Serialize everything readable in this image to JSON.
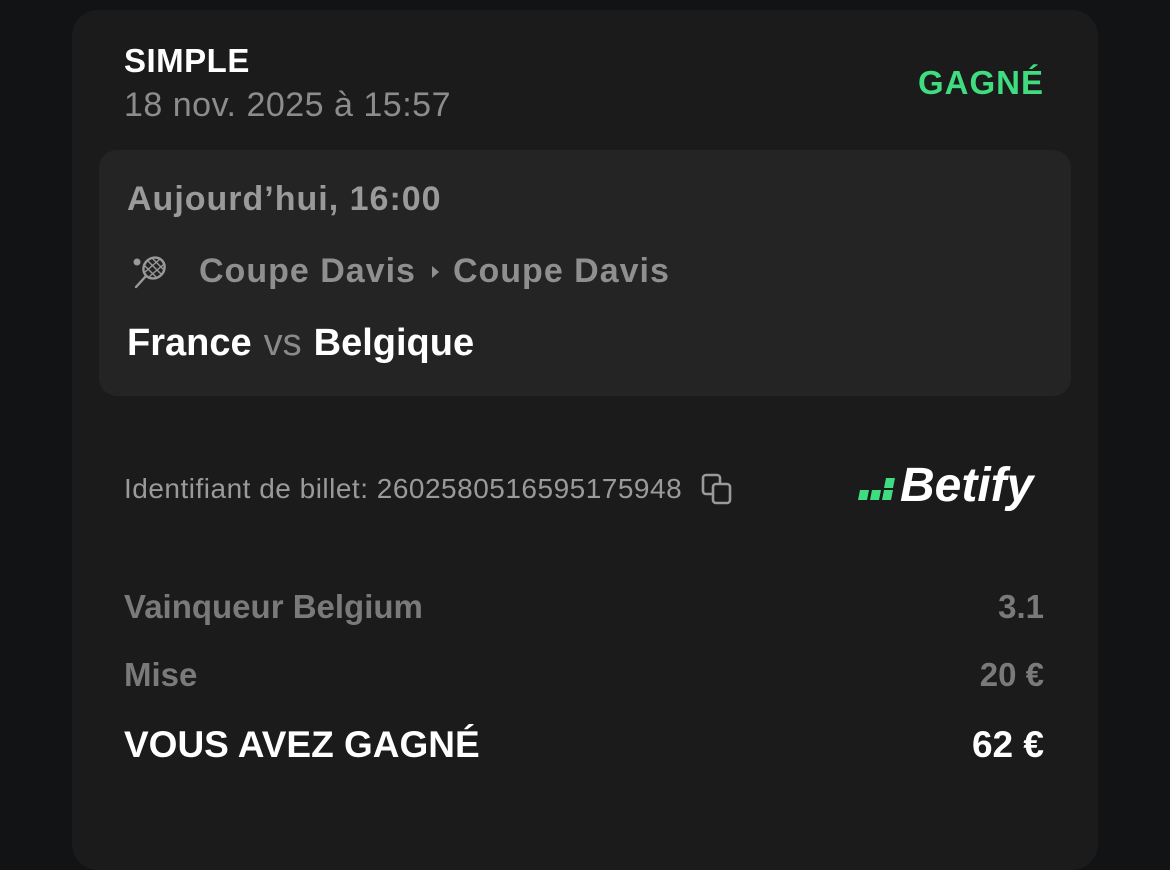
{
  "bet": {
    "type": "SIMPLE",
    "placed_at": "18 nov. 2025 à 15:57",
    "status": "GAGNÉ"
  },
  "event": {
    "time": "Aujourd’hui, 16:00",
    "sport_icon": "tennis-racket-icon",
    "competition": "Coupe Davis",
    "tournament": "Coupe Davis",
    "home_team": "France",
    "vs": "vs",
    "away_team": "Belgique"
  },
  "ticket": {
    "id_label": "Identifiant de billet: 2602580516595175948",
    "copy_icon": "copy-icon"
  },
  "brand": {
    "name": "Betify",
    "accent": "#3fdc80"
  },
  "details": {
    "selection_label": "Vainqueur Belgium",
    "odds": "3.1",
    "stake_label": "Mise",
    "stake_value": "20 €",
    "win_label": "VOUS AVEZ GAGNÉ",
    "win_value": "62 €"
  },
  "colors": {
    "background": "#121314",
    "card": "#1b1b1b",
    "event_box": "#242424",
    "win_green": "#3fdc80"
  }
}
